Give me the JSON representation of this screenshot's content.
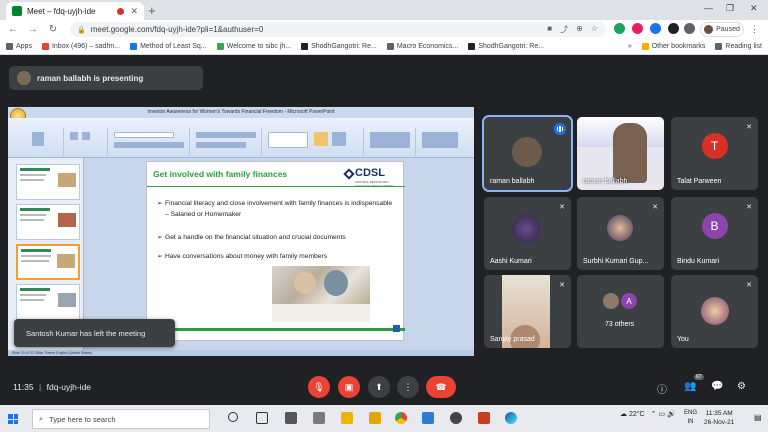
{
  "browser": {
    "tab_title": "Meet – fdq-uyjh-ide",
    "tab_close": "✕",
    "new_tab": "+",
    "url": "meet.google.com/fdq-uyjh-ide?pli=1&authuser=0",
    "profile_status": "Paused",
    "bookmarks": [
      {
        "label": "Apps",
        "color": "#5f6368"
      },
      {
        "label": "Inbox (496) – sadhn...",
        "color": "#ea4335"
      },
      {
        "label": "Method of Least Sq...",
        "color": "#1a73e8"
      },
      {
        "label": "Welcome to sibc jh...",
        "color": "#34a853"
      },
      {
        "label": "ShodhGangotri: Re...",
        "color": "#202124"
      },
      {
        "label": "Macro Economics...",
        "color": "#5f6368"
      },
      {
        "label": "ShodhGangotri: Re...",
        "color": "#202124"
      }
    ],
    "bookmarks_more": "»",
    "other_bookmarks": "Other bookmarks",
    "reading_list": "Reading list"
  },
  "meet": {
    "presenter_text": "raman ballabh is presenting",
    "toast": "Santosh Kumar has left the meeting",
    "time": "11:35",
    "separator": "|",
    "meeting_code": "fdq-uyjh-ide",
    "participant_count": "67",
    "participants": [
      {
        "name": "raman ballabh",
        "avatar": "",
        "color": "#3c4043",
        "speaking": true
      },
      {
        "name": "raman ballabh",
        "avatar": "",
        "color": "#3c4043",
        "speaking": false
      },
      {
        "name": "Talat Parween",
        "avatar": "T",
        "color": "#d93025",
        "speaking": false
      },
      {
        "name": "Aashi Kumari",
        "avatar": "",
        "color": "#3c4043",
        "speaking": false
      },
      {
        "name": "Surbhi Kumari Gup...",
        "avatar": "",
        "color": "#3c4043",
        "speaking": false
      },
      {
        "name": "Bindu Kumari",
        "avatar": "B",
        "color": "#8e44ad",
        "speaking": false
      },
      {
        "name": "Sanjay prasad",
        "avatar": "",
        "color": "#3c4043",
        "speaking": false
      },
      {
        "name": "73 others",
        "avatar": "A",
        "color": "#8e44ad",
        "speaking": false
      },
      {
        "name": "You",
        "avatar": "",
        "color": "#3c4043",
        "speaking": false
      }
    ]
  },
  "slide": {
    "window_title": "Investor Awareness for Women's Towards Financial Freedom - Microsoft PowerPoint",
    "title": "Get involved with family finances",
    "logo": "CDSL",
    "logo_tagline": "CENTRAL DEPOSITORY SERVICES (INDIA) LIMITED",
    "bullet_marker": "➢",
    "bullets": [
      "Financial literacy and close involvement with family finances is indispensable – Salaried or Homemaker",
      "Get a handle on the financial situation and crucial documents",
      "Have conversations about money with family members"
    ],
    "status_text": "Slide 20 of 32   Office Theme   English (United States)"
  },
  "taskbar": {
    "search_placeholder": "Type here to search",
    "temperature": "22°C",
    "lang": "ENG",
    "region": "IN",
    "time": "11:35 AM",
    "date": "26-Nov-21"
  }
}
